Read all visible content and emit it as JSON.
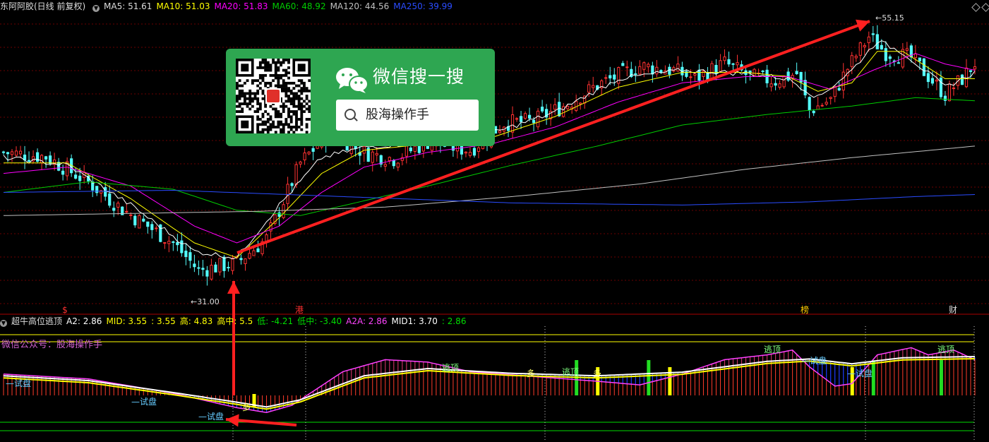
{
  "chart_data": [
    {
      "type": "candlestick",
      "title": "东阿阿胶(日线 前复权)",
      "indicators": [
        {
          "name": "MA5",
          "value": "51.61",
          "color": "#ffffff"
        },
        {
          "name": "MA10",
          "value": "51.03",
          "color": "#ffff00"
        },
        {
          "name": "MA20",
          "value": "51.83",
          "color": "#ff00ff"
        },
        {
          "name": "MA60",
          "value": "48.92",
          "color": "#00cc00"
        },
        {
          "name": "MA120",
          "value": "44.56",
          "color": "#c0c0c0"
        },
        {
          "name": "MA250",
          "value": "39.99",
          "color": "#2a4cff"
        }
      ],
      "ylim": [
        29.5,
        57.0
      ],
      "grid": true,
      "n": 230,
      "anchors_close": [
        [
          0,
          44.0
        ],
        [
          10,
          43.6
        ],
        [
          20,
          41.2
        ],
        [
          28,
          38.6
        ],
        [
          40,
          35.4
        ],
        [
          46,
          32.8
        ],
        [
          55,
          33.5
        ],
        [
          62,
          35.8
        ],
        [
          70,
          43.0
        ],
        [
          77,
          46.0
        ],
        [
          85,
          44.0
        ],
        [
          92,
          43.4
        ],
        [
          100,
          45.0
        ],
        [
          110,
          44.2
        ],
        [
          118,
          46.8
        ],
        [
          125,
          47.0
        ],
        [
          133,
          48.6
        ],
        [
          140,
          50.4
        ],
        [
          150,
          52.2
        ],
        [
          158,
          51.8
        ],
        [
          163,
          51.0
        ],
        [
          170,
          52.5
        ],
        [
          176,
          51.2
        ],
        [
          182,
          50.8
        ],
        [
          187,
          51.5
        ],
        [
          190,
          48.0
        ],
        [
          195,
          49.0
        ],
        [
          199,
          52.0
        ],
        [
          204,
          55.0
        ],
        [
          208,
          53.5
        ],
        [
          214,
          53.0
        ],
        [
          222,
          49.5
        ],
        [
          226,
          51.0
        ],
        [
          229,
          52.5
        ]
      ],
      "anchors_ma": {
        "ma5": [
          [
            0,
            43.5
          ],
          [
            15,
            42.8
          ],
          [
            30,
            39.0
          ],
          [
            45,
            34.6
          ],
          [
            55,
            34.0
          ],
          [
            65,
            39.0
          ],
          [
            75,
            43.5
          ],
          [
            85,
            44.5
          ],
          [
            100,
            45.0
          ],
          [
            115,
            45.8
          ],
          [
            130,
            47.8
          ],
          [
            145,
            51.0
          ],
          [
            160,
            51.8
          ],
          [
            175,
            51.5
          ],
          [
            185,
            51.0
          ],
          [
            192,
            49.2
          ],
          [
            200,
            51.8
          ],
          [
            206,
            54.6
          ],
          [
            212,
            53.5
          ],
          [
            222,
            50.2
          ],
          [
            229,
            51.6
          ]
        ],
        "ma10": [
          [
            0,
            43.0
          ],
          [
            15,
            43.0
          ],
          [
            30,
            39.6
          ],
          [
            45,
            35.4
          ],
          [
            55,
            34.0
          ],
          [
            65,
            37.8
          ],
          [
            75,
            42.0
          ],
          [
            85,
            44.2
          ],
          [
            100,
            44.8
          ],
          [
            115,
            45.4
          ],
          [
            130,
            47.4
          ],
          [
            145,
            50.2
          ],
          [
            160,
            51.6
          ],
          [
            175,
            51.6
          ],
          [
            185,
            51.2
          ],
          [
            192,
            49.8
          ],
          [
            200,
            50.6
          ],
          [
            206,
            53.6
          ],
          [
            212,
            53.6
          ],
          [
            222,
            51.0
          ],
          [
            229,
            51.0
          ]
        ],
        "ma20": [
          [
            0,
            42.0
          ],
          [
            15,
            42.6
          ],
          [
            30,
            40.8
          ],
          [
            45,
            37.0
          ],
          [
            55,
            35.4
          ],
          [
            65,
            37.0
          ],
          [
            75,
            40.2
          ],
          [
            85,
            42.6
          ],
          [
            100,
            44.0
          ],
          [
            115,
            44.8
          ],
          [
            130,
            46.4
          ],
          [
            145,
            48.8
          ],
          [
            160,
            50.6
          ],
          [
            175,
            51.2
          ],
          [
            185,
            51.2
          ],
          [
            195,
            50.0
          ],
          [
            205,
            51.8
          ],
          [
            215,
            53.4
          ],
          [
            222,
            52.4
          ],
          [
            229,
            51.8
          ]
        ],
        "ma60": [
          [
            0,
            40.2
          ],
          [
            20,
            41.2
          ],
          [
            40,
            40.5
          ],
          [
            55,
            38.5
          ],
          [
            70,
            38.0
          ],
          [
            85,
            39.4
          ],
          [
            100,
            40.8
          ],
          [
            120,
            42.8
          ],
          [
            140,
            44.6
          ],
          [
            160,
            46.6
          ],
          [
            180,
            47.6
          ],
          [
            200,
            48.4
          ],
          [
            215,
            49.2
          ],
          [
            229,
            48.9
          ]
        ],
        "ma120": [
          [
            0,
            38.0
          ],
          [
            30,
            38.2
          ],
          [
            60,
            38.4
          ],
          [
            90,
            38.8
          ],
          [
            120,
            39.8
          ],
          [
            150,
            41.0
          ],
          [
            175,
            42.4
          ],
          [
            200,
            43.5
          ],
          [
            229,
            44.6
          ]
        ],
        "ma250": [
          [
            0,
            40.2
          ],
          [
            40,
            40.4
          ],
          [
            80,
            39.8
          ],
          [
            120,
            39.2
          ],
          [
            160,
            39.0
          ],
          [
            190,
            39.3
          ],
          [
            215,
            39.8
          ],
          [
            229,
            40.0
          ]
        ]
      },
      "price_labels": [
        "55.15",
        "31.00"
      ],
      "event_markers": [
        "$",
        "港",
        "榜",
        "财"
      ]
    },
    {
      "type": "indicator",
      "title": "超牛高位逃顶",
      "values": [
        {
          "label": "A2: 2.86",
          "color": "#ffffff"
        },
        {
          "label": "MID: 3.55",
          "color": "#ffff00"
        },
        {
          "label": ": 3.55",
          "color": "#ffff00"
        },
        {
          "label": "高: 4.83",
          "color": "#ffff00"
        },
        {
          "label": "高中: 5.5",
          "color": "#ffff00"
        },
        {
          "label": "低: -4.21",
          "color": "#00dd00"
        },
        {
          "label": "低中: -3.40",
          "color": "#00dd00"
        },
        {
          "label": "A2A: 2.86",
          "color": "#ff44ff"
        },
        {
          "label": "MID1: 3.70",
          "color": "#ffffff"
        },
        {
          "label": ": 2.86",
          "color": "#00dd00"
        }
      ],
      "note": "微信公众号：股海操作手",
      "signals_escape": [
        "逃顶",
        "逃顶",
        "逃顶",
        "逃顶"
      ],
      "signals_trial": [
        "试盘",
        "试盘",
        "试盘",
        "试盘",
        "试盘"
      ],
      "signals_more": [
        "多",
        "多",
        "多"
      ]
    }
  ],
  "overlay": {
    "title": "微信搜一搜",
    "search_text": "股海操作手"
  }
}
